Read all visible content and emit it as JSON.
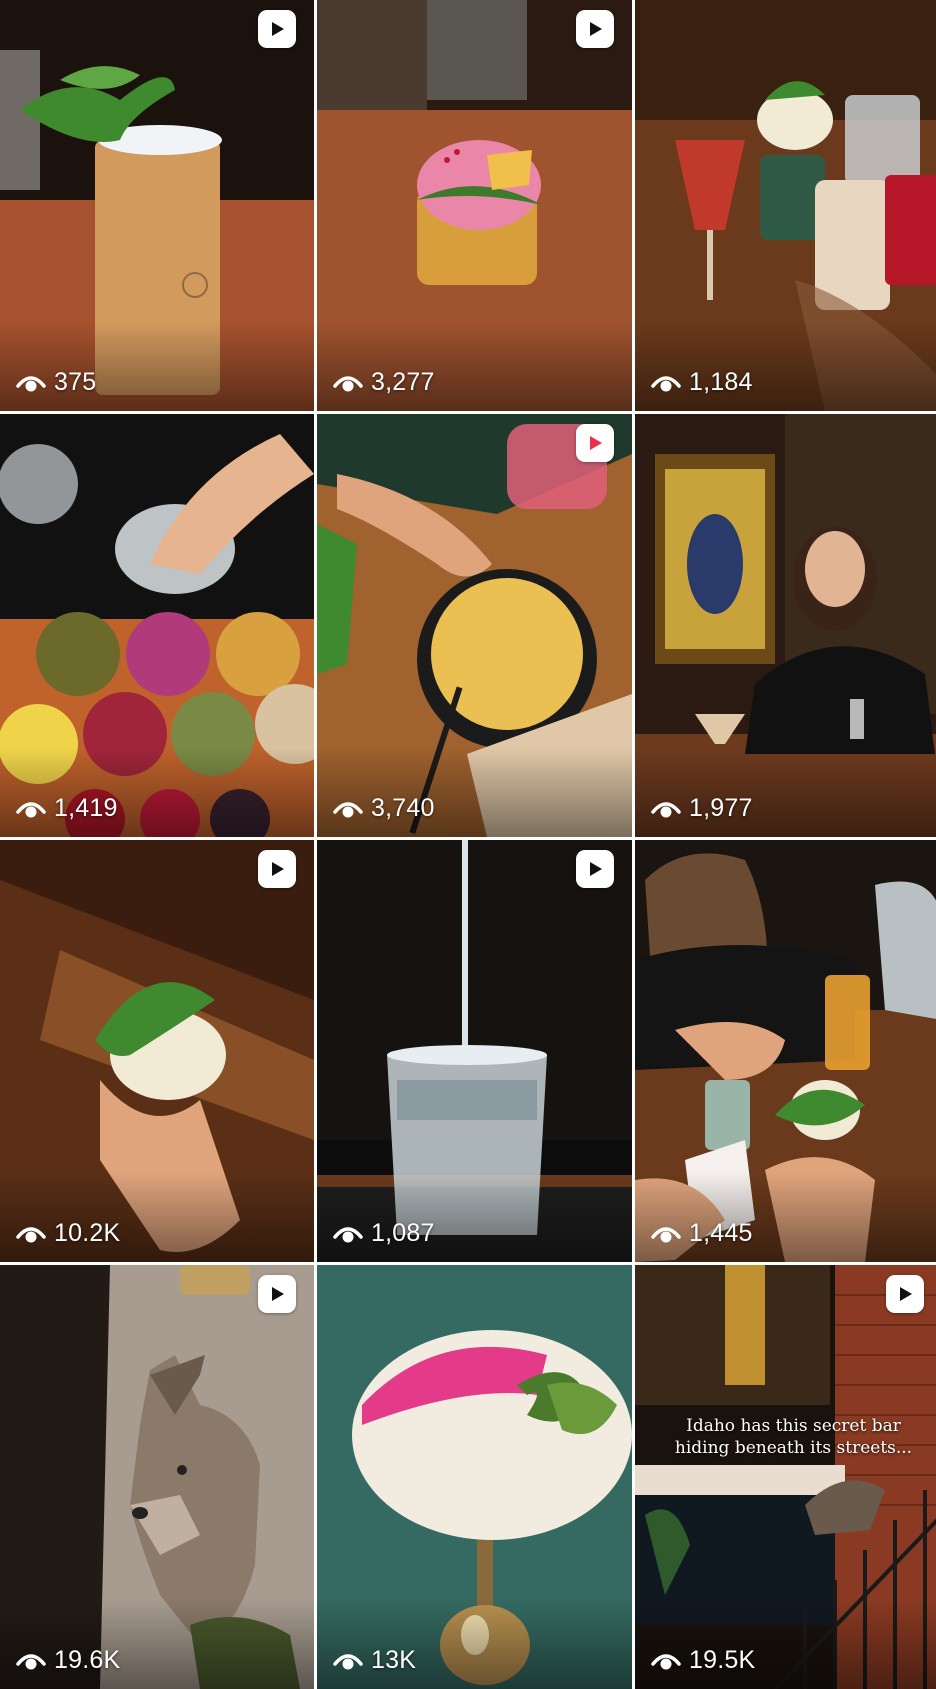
{
  "tiles": [
    {
      "views": "375",
      "reel": true,
      "scene": "wooden tumbler cocktail with mint on bar"
    },
    {
      "views": "3,277",
      "reel": true,
      "scene": "pink foam cocktail with wafer on copper bar"
    },
    {
      "views": "1,184",
      "reel": false,
      "scene": "assorted cocktails on bar"
    },
    {
      "views": "1,419",
      "reel": false,
      "scene": "hands garnishing drink over jars of botanicals"
    },
    {
      "views": "3,740",
      "reel": true,
      "scene": "skillet of fries with cheese and flatbread"
    },
    {
      "views": "1,977",
      "reel": false,
      "scene": "bartender serving espresso martini"
    },
    {
      "views": "10.2K",
      "reel": true,
      "scene": "hand holding mint cocktail over wood table"
    },
    {
      "views": "1,087",
      "reel": true,
      "scene": "pour into glass of ice"
    },
    {
      "views": "1,445",
      "reel": false,
      "scene": "guests playing cards with drinks"
    },
    {
      "views": "19.6K",
      "reel": true,
      "scene": "taxidermy coyote"
    },
    {
      "views": "13K",
      "reel": false,
      "scene": "white foam cocktail with pink dust and cucumber"
    },
    {
      "views": "19.5K",
      "reel": true,
      "scene": "staircase and brick wall",
      "caption": "Idaho has this secret bar hiding beneath its streets..."
    }
  ],
  "colors": {
    "reel_icon_bg": "#ffffff",
    "reel_icon_fg": "#111111",
    "reel_icon_pink": "#e8324a",
    "view_text": "#ffffff"
  },
  "icons": {
    "views": "eye-icon",
    "reel": "reel-play-icon"
  }
}
